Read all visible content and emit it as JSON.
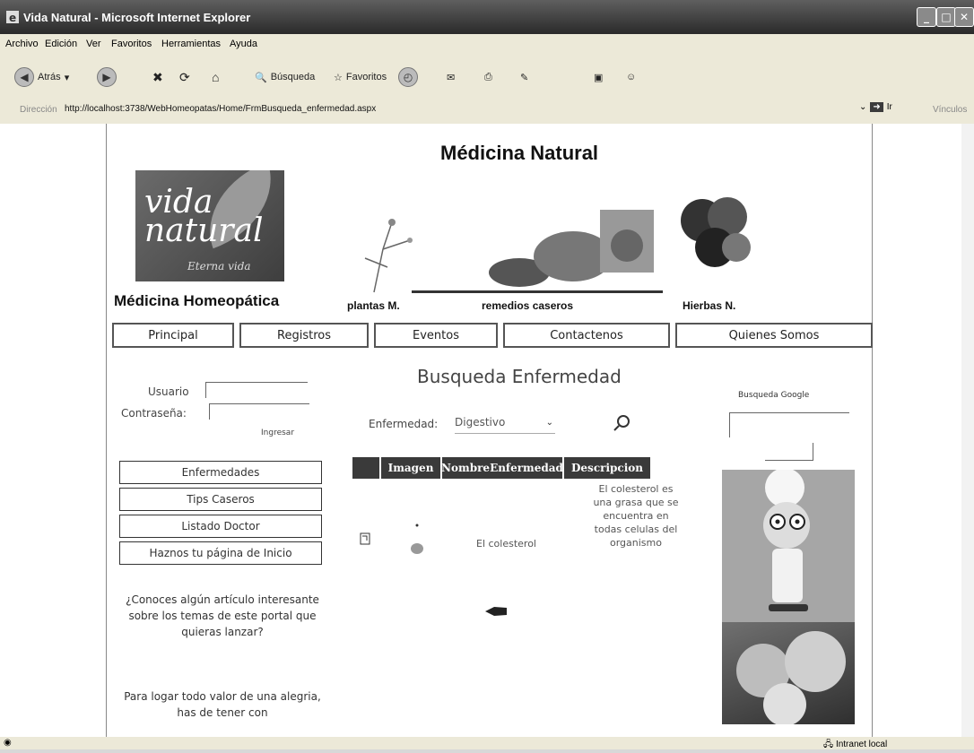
{
  "window": {
    "title": "Vida Natural - Microsoft Internet Explorer"
  },
  "menu": {
    "items": [
      "Archivo",
      "Edición",
      "Ver",
      "Favoritos",
      "Herramientas",
      "Ayuda"
    ]
  },
  "toolbar": {
    "back": "Atrás",
    "search": "Búsqueda",
    "favorites": "Favoritos"
  },
  "address": {
    "label": "Dirección",
    "url": "http://localhost:3738/WebHomeopatas/Home/FrmBusqueda_enfermedad.aspx",
    "go": "Ir",
    "links": "Vínculos"
  },
  "status": {
    "zone": "Intranet local"
  },
  "site": {
    "title": "Médicina Natural",
    "logo": {
      "line1": "vida",
      "line2": "natural",
      "tagline": "Eterna vida"
    },
    "subtitle": "Médicina Homeopática",
    "hero_labels": [
      "plantas M.",
      "remedios caseros",
      "Hierbas N."
    ],
    "nav": [
      "Principal",
      "Registros",
      "Eventos",
      "Contactenos",
      "Quienes Somos"
    ],
    "login": {
      "user_label": "Usuario",
      "pass_label": "Contraseña:",
      "submit": "Ingresar"
    },
    "side_menu": [
      "Enfermedades",
      "Tips Caseros",
      "Listado Doctor",
      "Haznos tu página de Inicio"
    ],
    "side_text1": "¿Conoces algún artículo interesante sobre los temas de este portal que quieras lanzar?",
    "side_text2": "Para logar todo valor de una alegria, has de tener con",
    "main_title": "Busqueda Enfermedad",
    "filter": {
      "label": "Enfermedad:",
      "value": "Digestivo"
    },
    "table": {
      "headers": [
        "",
        "Imagen",
        "NombreEnfermedad",
        "Descripcion"
      ],
      "row": {
        "name": "El colesterol",
        "description": "El colesterol es una grasa que se encuentra en todas celulas del organismo"
      }
    },
    "google": {
      "label": "Busqueda Google"
    }
  }
}
